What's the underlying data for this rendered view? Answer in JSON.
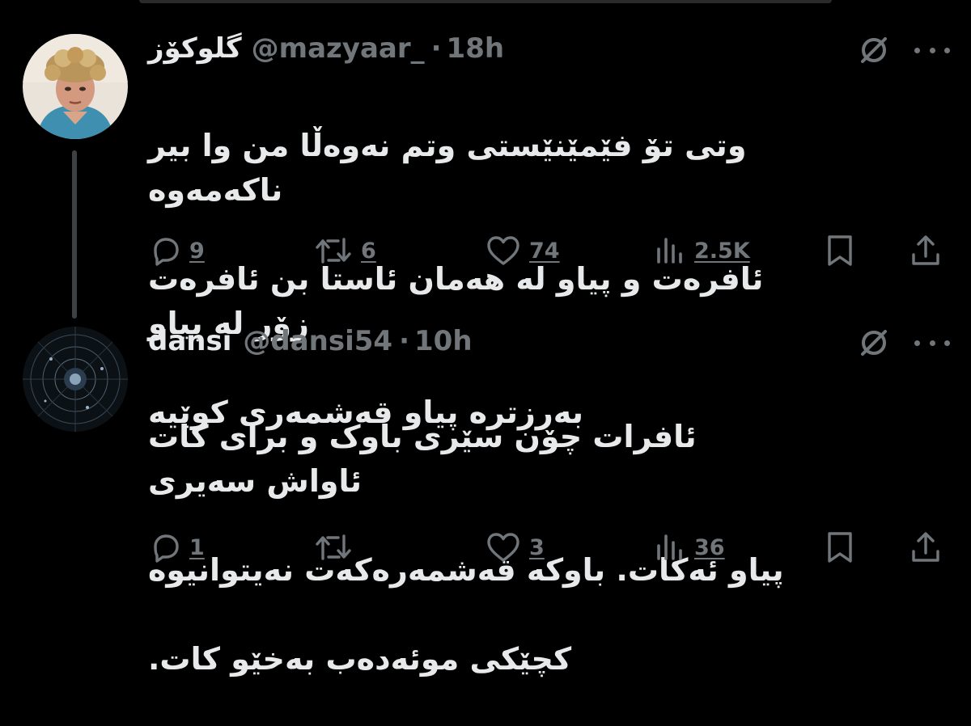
{
  "tweets": [
    {
      "display_name": "گلوکۆز",
      "handle": "@mazyaar_",
      "separator": "·",
      "time": "18h",
      "text_lines": [
        "وتی تۆ فێمێنێستی وتم نەوەڵا من وا بیر ناکەمەوە",
        "ئافرەت و پیاو لە هەمان ئاستا بن ئافرەت زۆر لە پیاو",
        "بەرزترە پیاو قەشمەری کوێیە"
      ],
      "replies": "9",
      "reposts": "6",
      "likes": "74",
      "views": "2.5K",
      "icons": [
        "grok-icon",
        "more-icon",
        "reply-icon",
        "repost-icon",
        "like-icon",
        "views-icon",
        "bookmark-icon",
        "share-icon"
      ]
    },
    {
      "display_name": "dansi",
      "handle": "@dansi54",
      "separator": "·",
      "time": "10h",
      "text_lines": [
        "ئافرات چۆن سێری باوک و برای کات ئاواش سەیری",
        "پیاو ئەکات. باوکە قەشمەرەکەت نەیتوانیوە",
        "کچێکی موئەدەب بەخێو کات."
      ],
      "replies": "1",
      "reposts": "",
      "likes": "3",
      "views": "36",
      "icons": [
        "grok-icon",
        "more-icon",
        "reply-icon",
        "repost-icon",
        "like-icon",
        "views-icon",
        "bookmark-icon",
        "share-icon"
      ]
    }
  ],
  "colors": {
    "background": "#000000",
    "primary_text": "#e7e9ea",
    "secondary_text": "#71767b",
    "thread_line": "#3e4144"
  }
}
